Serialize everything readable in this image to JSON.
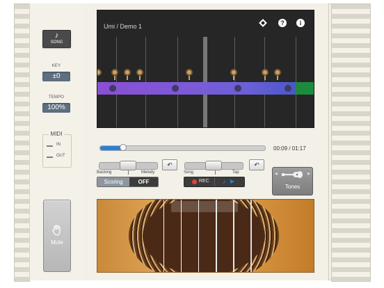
{
  "left": {
    "song_button_label": "SONG",
    "key_label": "KEY",
    "key_value": "±0",
    "tempo_label": "TEMPO",
    "tempo_value": "100%",
    "midi_label": "MIDI",
    "midi_in": "IN",
    "midi_out": "OUT",
    "mute_label": "Mute"
  },
  "screen": {
    "title": "Umi / Demo 1",
    "icons": [
      "gear-icon",
      "help-icon",
      "info-icon"
    ]
  },
  "transport": {
    "time": "00:09 / 01:17",
    "progress": 0.14
  },
  "mixer": {
    "left_slider": {
      "left_label": "Backing",
      "right_label": "Melody",
      "level": 0.5
    },
    "right_slider": {
      "left_label": "Song",
      "right_label": "Tap",
      "level": 0.5
    },
    "scoring_label": "Scoring",
    "scoring_value": "OFF",
    "rec_label": "REC"
  },
  "tones": {
    "label": "Tones"
  },
  "colors": {
    "accent_blue": "#2b7fd6",
    "rec_red": "#e1443b",
    "band_purple": "#8a4fd2",
    "band_green": "#1c8b3d"
  }
}
